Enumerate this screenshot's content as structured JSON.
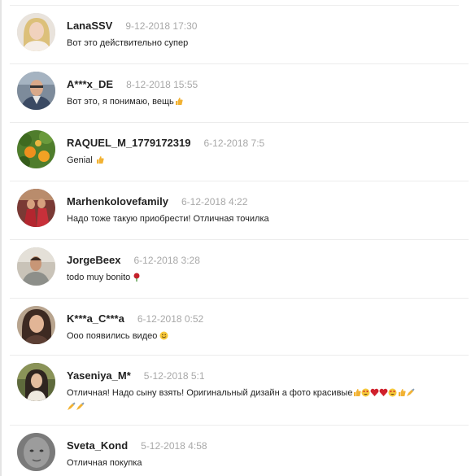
{
  "comments": [
    {
      "author": "LanaSSV",
      "date": "9-12-2018 17:30",
      "text": "Вот это действительно супер",
      "emoji": []
    },
    {
      "author": "A***x_DE",
      "date": "8-12-2018 15:55",
      "text": "Вот это, я понимаю, вещь",
      "emoji": [
        "thumbs-up"
      ]
    },
    {
      "author": "RAQUEL_M_1779172319",
      "date": "6-12-2018 7:5",
      "text": "Genial ",
      "emoji": [
        "thumbs-up"
      ]
    },
    {
      "author": "Marhenkolovefamily",
      "date": "6-12-2018 4:22",
      "text": "Надо тоже такую приобрести! Отличная точилка",
      "emoji": []
    },
    {
      "author": "JorgeBeex",
      "date": "6-12-2018 3:28",
      "text": "todo muy bonito ",
      "emoji": [
        "rose"
      ]
    },
    {
      "author": "K***a_C***a",
      "date": "6-12-2018 0:52",
      "text": "Ооо появились видео ",
      "emoji": [
        "smiley"
      ]
    },
    {
      "author": "Yaseniya_M*",
      "date": "5-12-2018 5:1",
      "text": "Отличная! Надо сыну взять! Оригинальный дизайн а фото красивые",
      "emoji": [
        "thumbs-up",
        "heart-eyes",
        "hearts",
        "heart-eyes",
        "thumbs-up",
        "writing-hand",
        "writing-hand",
        "writing-hand"
      ]
    },
    {
      "author": "Sveta_Kond",
      "date": "5-12-2018 4:58",
      "text": "Отличная покупка",
      "emoji": []
    }
  ],
  "colors": {
    "author": "#222222",
    "date": "#a8a8a8",
    "divider": "#ececec",
    "thumb": "#f2b233"
  }
}
